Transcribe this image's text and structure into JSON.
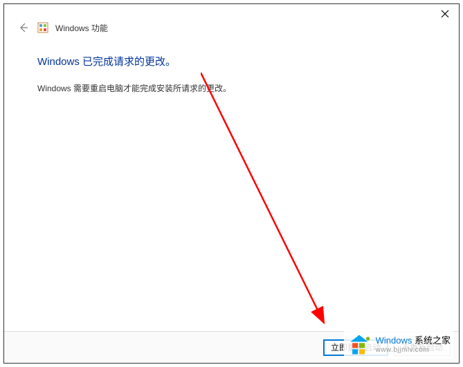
{
  "dialog": {
    "window_title": "Windows 功能",
    "heading": "Windows 已完成请求的更改。",
    "description": "Windows 需要重启电脑才能完成安装所请求的更改。",
    "restart_button": "立即重新启动",
    "no_restart_button": "不重新启动"
  },
  "watermark": {
    "brand_main": "Windows",
    "brand_sub": "系统之家",
    "url": "www.bjjmlv.com"
  }
}
